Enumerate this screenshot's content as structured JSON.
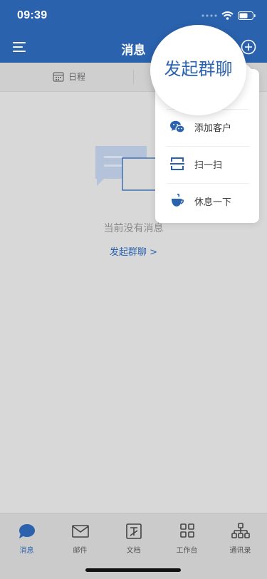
{
  "status_bar": {
    "time": "09:39"
  },
  "header": {
    "title": "消息"
  },
  "subbar": {
    "schedule_label": "日程"
  },
  "empty_state": {
    "text": "当前没有消息",
    "link": "发起群聊 >"
  },
  "popup": {
    "items": [
      {
        "label": "发起群聊",
        "icon": "group-chat-icon"
      },
      {
        "label": "添加客户",
        "icon": "wechat-icon"
      },
      {
        "label": "扫一扫",
        "icon": "scan-icon"
      },
      {
        "label": "休息一下",
        "icon": "coffee-icon"
      }
    ]
  },
  "tabbar": {
    "tabs": [
      {
        "label": "消息",
        "icon": "message-icon",
        "active": true
      },
      {
        "label": "邮件",
        "icon": "mail-icon"
      },
      {
        "label": "文档",
        "icon": "document-icon"
      },
      {
        "label": "工作台",
        "icon": "workbench-icon"
      },
      {
        "label": "通讯录",
        "icon": "contacts-icon"
      }
    ]
  },
  "colors": {
    "accent": "#2a62ae",
    "overlay_gray": "#d8d8d8",
    "popup_bg": "#ffffff"
  }
}
